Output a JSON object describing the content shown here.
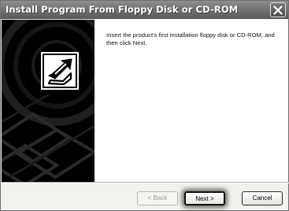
{
  "window": {
    "title": "Install Program From Floppy Disk or CD-ROM"
  },
  "content": {
    "instruction": "Insert the product's first installation floppy disk or CD-ROM, and then click Next."
  },
  "buttons": {
    "back": "< Back",
    "next": "Next >",
    "cancel": "Cancel"
  },
  "icons": {
    "close": "close-icon",
    "setup": "setup-arrow-icon",
    "artwork": "cd-disk-artwork"
  }
}
